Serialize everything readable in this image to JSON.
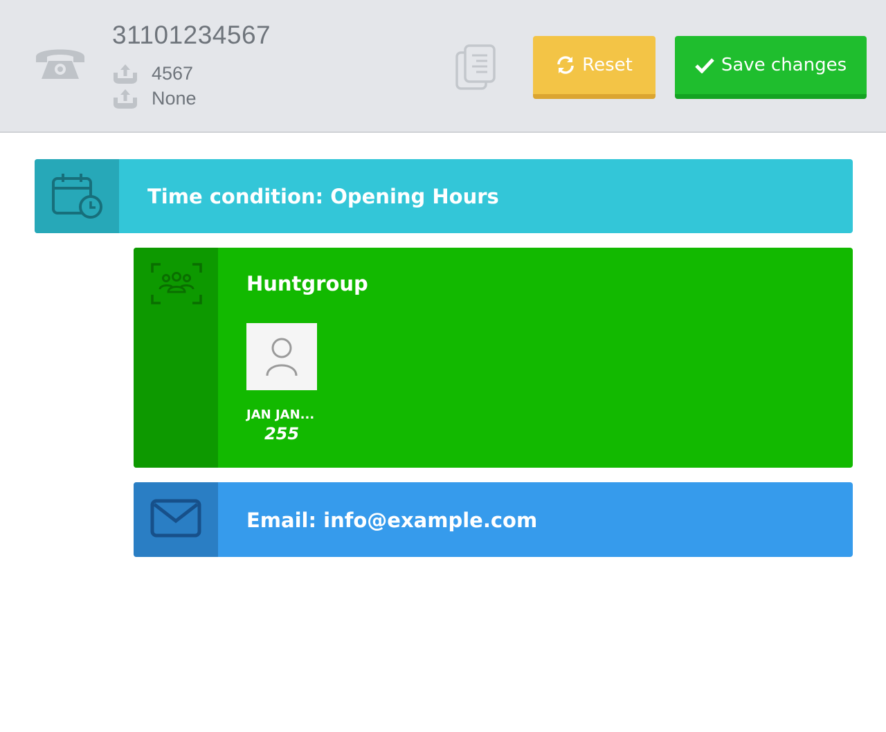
{
  "header": {
    "number": "31101234567",
    "lines": [
      "4567",
      "None"
    ],
    "reset_label": "Reset",
    "save_label": "Save changes"
  },
  "cards": {
    "time_condition": {
      "title": "Time condition: Opening Hours",
      "icon": "calendar-clock-icon"
    },
    "huntgroup": {
      "title": "Huntgroup",
      "icon": "group-icon",
      "members": [
        {
          "name": "JAN JAN...",
          "extension": "255"
        }
      ]
    },
    "email": {
      "title": "Email: info@example.com",
      "icon": "envelope-icon"
    }
  },
  "colors": {
    "header_bg": "#e4e6ea",
    "reset": "#f3c446",
    "save": "#1fbe2e",
    "time_condition": "#33c6d8",
    "huntgroup": "#12b900",
    "email": "#369bec"
  }
}
